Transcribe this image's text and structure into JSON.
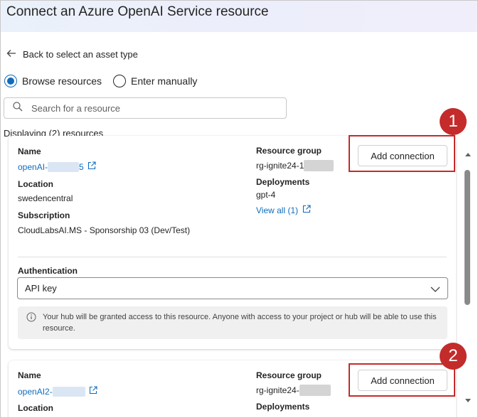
{
  "header": {
    "title": "Connect an Azure OpenAI Service resource"
  },
  "nav": {
    "back_label": "Back to select an asset type"
  },
  "mode": {
    "options": [
      {
        "label": "Browse resources",
        "selected": true
      },
      {
        "label": "Enter manually",
        "selected": false
      }
    ]
  },
  "search": {
    "placeholder": "Search for a resource"
  },
  "results": {
    "count_text": "Displaying (2) resources"
  },
  "resources": [
    {
      "name_label": "Name",
      "name_value": "openAI-",
      "name_suffix": "5",
      "location_label": "Location",
      "location_value": "swedencentral",
      "subscription_label": "Subscription",
      "subscription_value": "CloudLabsAI.MS - Sponsorship 03 (Dev/Test)",
      "resource_group_label": "Resource group",
      "resource_group_value": "rg-ignite24-",
      "resource_group_suffix": "1",
      "deployments_label": "Deployments",
      "deployments_value": "gpt-4",
      "view_all_label": "View all (1)",
      "add_label": "Add connection",
      "auth_label": "Authentication",
      "auth_value": "API key",
      "info_text": "Your hub will be granted access to this resource. Anyone with access to your project or hub will be able to use this resource."
    },
    {
      "name_label": "Name",
      "name_value": "openAI2-",
      "location_label": "Location",
      "resource_group_label": "Resource group",
      "resource_group_value": "rg-ignite24-",
      "deployments_label": "Deployments",
      "add_label": "Add connection"
    }
  ],
  "callouts": [
    "1",
    "2"
  ],
  "colors": {
    "accent": "#0f6cbd",
    "callout": "#c42b2b"
  }
}
